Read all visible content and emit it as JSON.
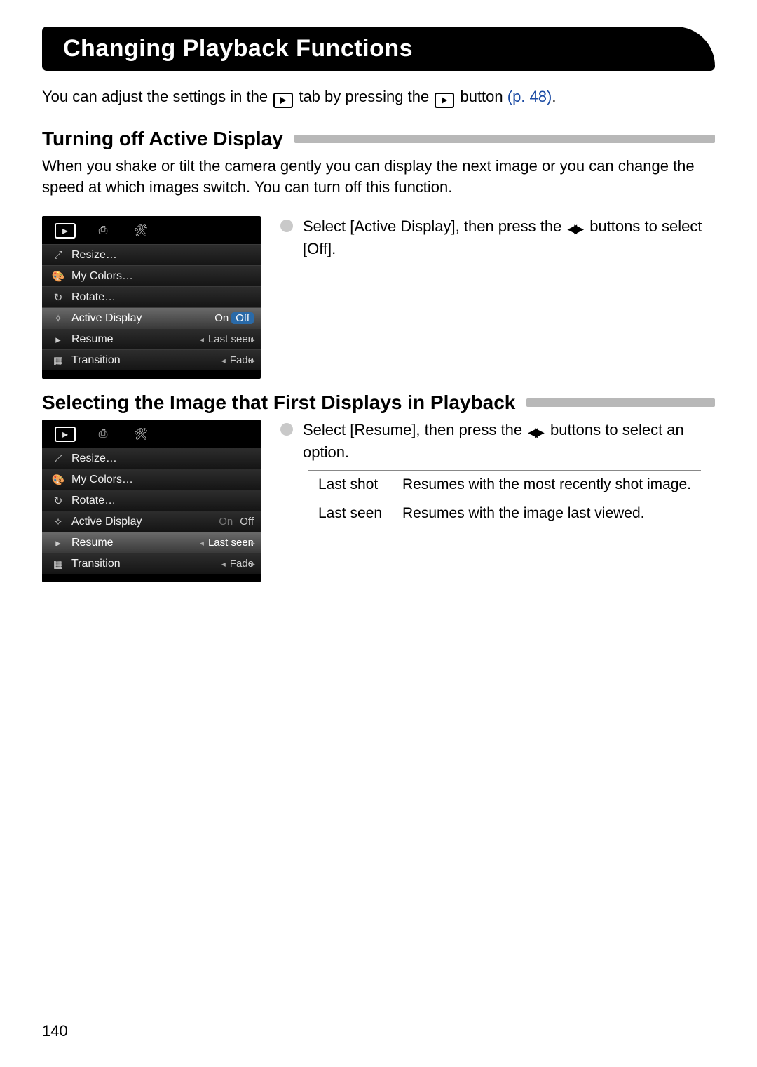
{
  "title": "Changing Playback Functions",
  "intro": {
    "part1": "You can adjust the settings in the ",
    "part2": " tab by pressing the ",
    "part3": " button ",
    "link": "(p. 48)",
    "part4": "."
  },
  "section1": {
    "heading": "Turning off Active Display",
    "body": "When you shake or tilt the camera gently you can display the next image or you can change the speed at which images switch. You can turn off this function.",
    "side_text_a": "Select [Active Display], then press the ",
    "side_text_b": " buttons to select [Off]."
  },
  "section2": {
    "heading": "Selecting the Image that First Displays in Playback",
    "side_text_a": "Select [Resume], then press the ",
    "side_text_b": " buttons to select an option.",
    "options": [
      {
        "name": "Last shot",
        "desc": "Resumes with the most recently shot image."
      },
      {
        "name": "Last seen",
        "desc": "Resumes with the image last viewed."
      }
    ]
  },
  "menu_common": {
    "items": {
      "resize": "Resize…",
      "mycolors": "My Colors…",
      "rotate": "Rotate…",
      "active_display": "Active Display",
      "resume": "Resume",
      "transition": "Transition"
    },
    "values": {
      "on": "On",
      "off": "Off",
      "last_seen": "Last seen",
      "fade": "Fade"
    }
  },
  "menu1": {
    "selected": "active_display",
    "active_display_val_sel": "Off",
    "active_display_val_dim": "On",
    "resume_val": "Last seen",
    "transition_val": "Fade"
  },
  "menu2": {
    "selected": "resume",
    "active_display_val_dim": "On",
    "active_display_val": "Off",
    "resume_val": "Last seen",
    "transition_val": "Fade"
  },
  "page_number": "140"
}
